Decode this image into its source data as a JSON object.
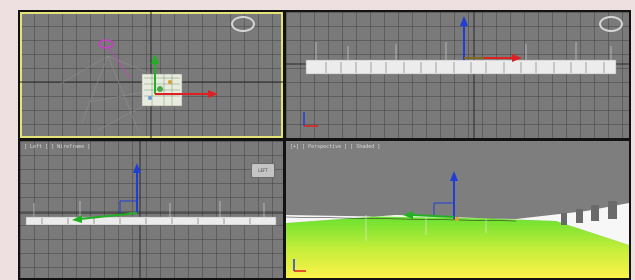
{
  "viewports": {
    "top": {
      "label": ""
    },
    "front": {
      "label": ""
    },
    "left": {
      "label": "[ Left ] [ Wireframe ]"
    },
    "perspective": {
      "label": "[+] [ Perspective ] [ Shaded ]"
    }
  },
  "viewcube_labels": {
    "left": "LEFT",
    "perspective": ""
  },
  "colors": {
    "axis_x": "#e02020",
    "axis_y": "#20b020",
    "axis_z": "#1e3ed6",
    "active_border": "#e6e27a",
    "grid_bg": "#7a7a7a"
  },
  "icons": [
    "gizmo-icon",
    "viewcube-icon",
    "light-icon",
    "camera-icon"
  ]
}
